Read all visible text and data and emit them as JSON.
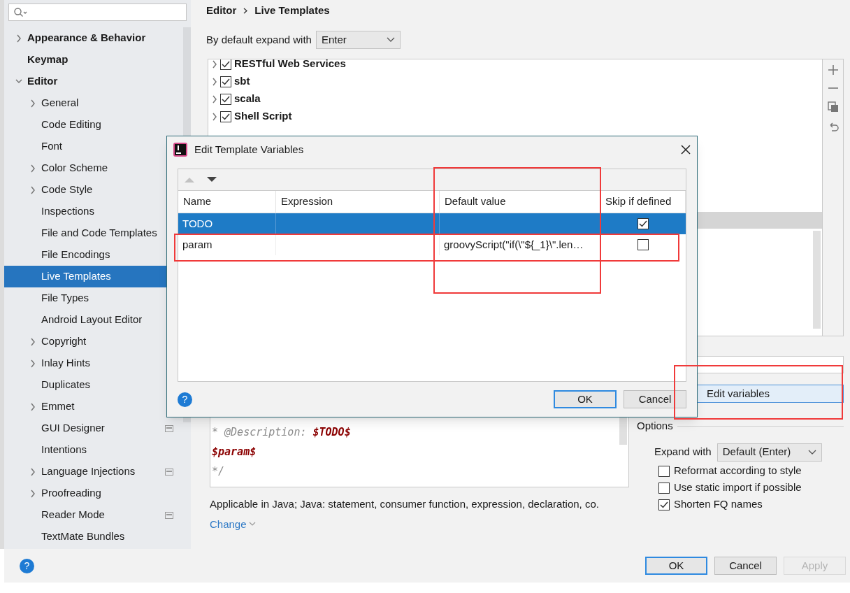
{
  "sidebar": {
    "items": [
      {
        "label": "Appearance & Behavior",
        "kind": "folder",
        "expanded": false,
        "selected": false
      },
      {
        "label": "Keymap",
        "kind": "leaf",
        "selected": false
      },
      {
        "label": "Editor",
        "kind": "folder",
        "expanded": true,
        "selected": false,
        "children": [
          {
            "label": "General",
            "kind": "folder",
            "expanded": false,
            "selected": false,
            "project_icon": false
          },
          {
            "label": "Code Editing",
            "kind": "leaf",
            "selected": false,
            "project_icon": false
          },
          {
            "label": "Font",
            "kind": "leaf",
            "selected": false,
            "project_icon": false
          },
          {
            "label": "Color Scheme",
            "kind": "folder",
            "expanded": false,
            "selected": false,
            "project_icon": false
          },
          {
            "label": "Code Style",
            "kind": "folder",
            "expanded": false,
            "selected": false,
            "project_icon": false
          },
          {
            "label": "Inspections",
            "kind": "leaf",
            "selected": false,
            "project_icon": false
          },
          {
            "label": "File and Code Templates",
            "kind": "leaf",
            "selected": false,
            "project_icon": false
          },
          {
            "label": "File Encodings",
            "kind": "leaf",
            "selected": false,
            "project_icon": false
          },
          {
            "label": "Live Templates",
            "kind": "leaf",
            "selected": true,
            "project_icon": false
          },
          {
            "label": "File Types",
            "kind": "leaf",
            "selected": false,
            "project_icon": false
          },
          {
            "label": "Android Layout Editor",
            "kind": "leaf",
            "selected": false,
            "project_icon": false
          },
          {
            "label": "Copyright",
            "kind": "folder",
            "expanded": false,
            "selected": false,
            "project_icon": false
          },
          {
            "label": "Inlay Hints",
            "kind": "folder",
            "expanded": false,
            "selected": false,
            "project_icon": false
          },
          {
            "label": "Duplicates",
            "kind": "leaf",
            "selected": false,
            "project_icon": false
          },
          {
            "label": "Emmet",
            "kind": "folder",
            "expanded": false,
            "selected": false,
            "project_icon": false
          },
          {
            "label": "GUI Designer",
            "kind": "leaf",
            "selected": false,
            "project_icon": true
          },
          {
            "label": "Intentions",
            "kind": "leaf",
            "selected": false,
            "project_icon": false
          },
          {
            "label": "Language Injections",
            "kind": "folder",
            "expanded": false,
            "selected": false,
            "project_icon": true
          },
          {
            "label": "Proofreading",
            "kind": "folder",
            "expanded": false,
            "selected": false,
            "project_icon": false
          },
          {
            "label": "Reader Mode",
            "kind": "leaf",
            "selected": false,
            "project_icon": true
          },
          {
            "label": "TextMate Bundles",
            "kind": "leaf",
            "selected": false,
            "project_icon": false
          }
        ]
      }
    ]
  },
  "breadcrumb": [
    "Editor",
    "Live Templates"
  ],
  "expand_default": {
    "label": "By default expand with",
    "value": "Enter"
  },
  "template_groups": [
    {
      "label": "RESTful Web Services",
      "checked": true
    },
    {
      "label": "sbt",
      "checked": true
    },
    {
      "label": "scala",
      "checked": true
    },
    {
      "label": "Shell Script",
      "checked": true
    }
  ],
  "help_icon": "?",
  "template_text": [
    [
      {
        "text": "* @Description: ",
        "kind": "comment"
      },
      {
        "text": "$TODO$",
        "kind": "variable"
      }
    ],
    [
      {
        "text": "$param$",
        "kind": "variable"
      }
    ],
    [
      {
        "text": "*/",
        "kind": "comment"
      }
    ]
  ],
  "applicable": "Applicable in Java; Java: statement, consumer function, expression, declaration, co.",
  "change_link": "Change",
  "edit_variables_button": "Edit variables",
  "options": {
    "title": "Options",
    "expand_with": {
      "label": "Expand with",
      "value": "Default (Enter)"
    },
    "checkboxes": [
      {
        "label": "Reformat according to style",
        "checked": false
      },
      {
        "label": "Use static import if possible",
        "checked": false
      },
      {
        "label": "Shorten FQ names",
        "checked": true
      }
    ]
  },
  "buttons": [
    "OK",
    "Cancel",
    "Apply"
  ],
  "dialog": {
    "title": "Edit Template Variables",
    "columns": [
      "Name",
      "Expression",
      "Default value",
      "Skip if defined"
    ],
    "rows": [
      {
        "name": "TODO",
        "skip_if_defined": true,
        "selected": true
      },
      {
        "name": "param",
        "default_value": "groovyScript(\"if(\\\"${_1}\\\".len…",
        "skip_if_defined": false,
        "selected": false
      }
    ],
    "buttons": [
      "OK",
      "Cancel"
    ],
    "help_icon": "?"
  }
}
